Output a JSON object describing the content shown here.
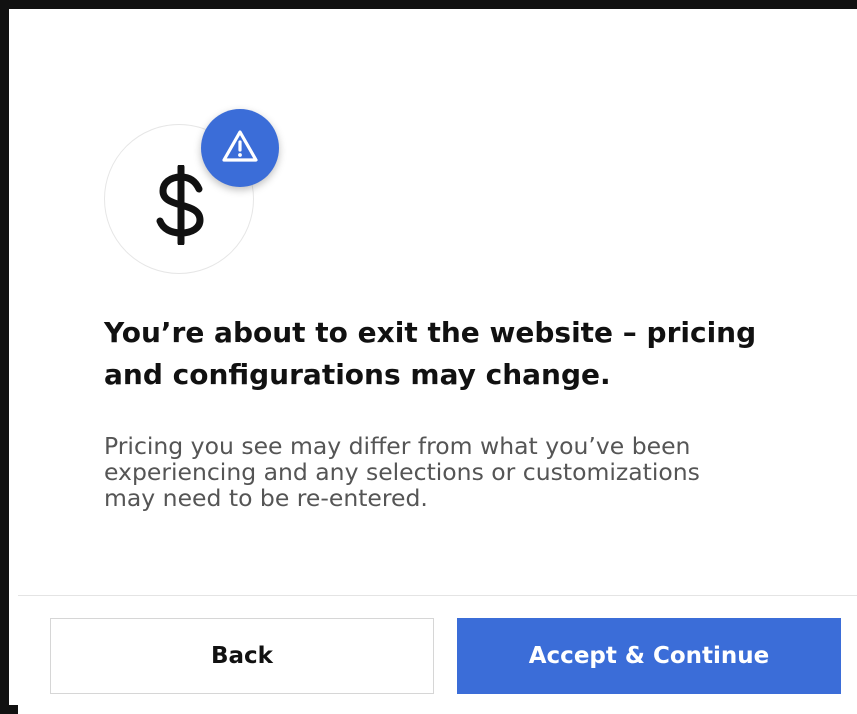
{
  "icons": {
    "main": "dollar-sign-icon",
    "badge": "warning-triangle-icon"
  },
  "colors": {
    "accent": "#3b6dd8",
    "headline_text": "#111111",
    "body_text": "#555555",
    "frame": "#111111"
  },
  "dialog": {
    "headline": "You’re about to exit the website – pricing and configurations may change.",
    "body": "Pricing you see may differ from what you’ve been experiencing and any selections or customizations may need to be re-entered."
  },
  "actions": {
    "back_label": "Back",
    "accept_label": "Accept & Continue"
  }
}
